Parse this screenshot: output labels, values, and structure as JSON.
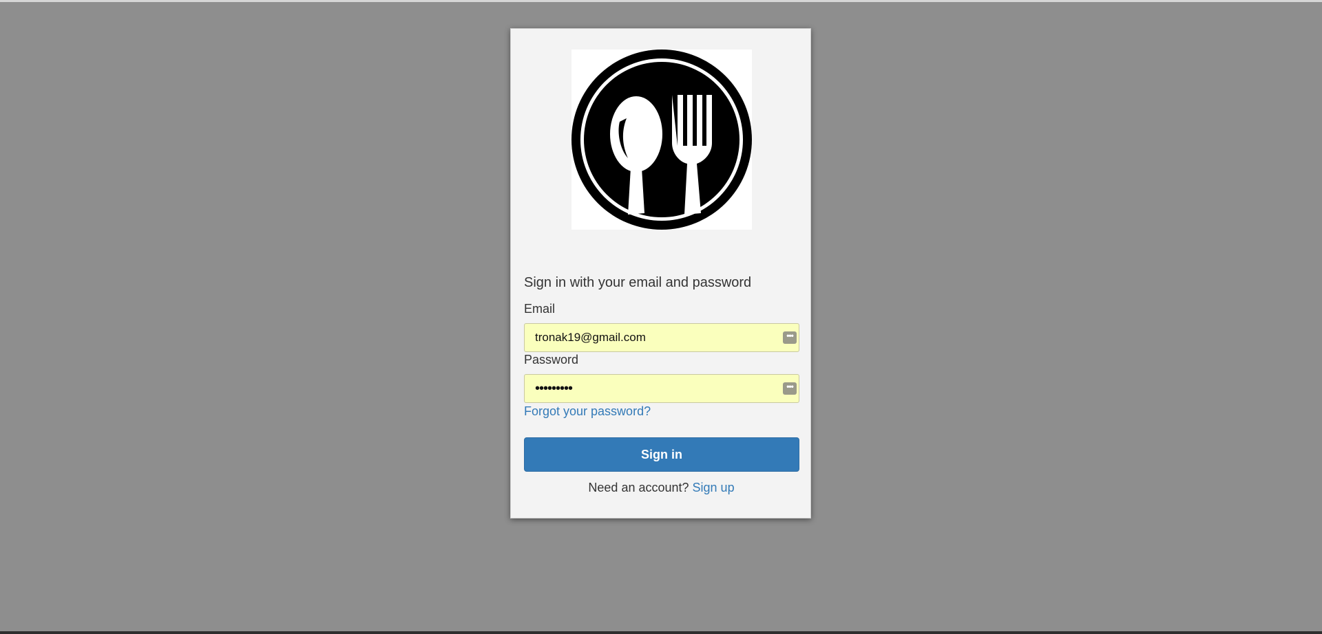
{
  "login": {
    "heading": "Sign in with your email and password",
    "email_label": "Email",
    "email_value": "tronak19@gmail.com",
    "password_label": "Password",
    "password_value": "•••••••••",
    "forgot_link": "Forgot your password?",
    "signin_button": "Sign in",
    "need_account_text": "Need an account?",
    "signup_link": "Sign up",
    "autofill_icon_glyph": "•••"
  },
  "logo": {
    "icon": "spoon-fork-plate-logo"
  },
  "colors": {
    "background": "#8e8e8e",
    "card": "#f3f3f3",
    "primary": "#337ab7",
    "autofill": "#faffbd"
  }
}
